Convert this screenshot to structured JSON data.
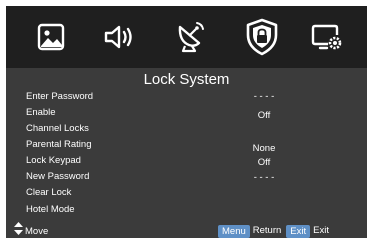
{
  "colors": {
    "top_bar": "#1f1f1f",
    "panel": "#3b3b3b",
    "icon": "#ffffff",
    "key_highlight": "#5f90c6"
  },
  "tabs": [
    {
      "icon": "picture-icon",
      "active": false
    },
    {
      "icon": "sound-icon",
      "active": false
    },
    {
      "icon": "channel-satellite-icon",
      "active": false
    },
    {
      "icon": "lock-shield-icon",
      "active": true
    },
    {
      "icon": "settings-monitor-icon",
      "active": false
    }
  ],
  "menu": {
    "title": "Lock System",
    "items": [
      {
        "label": "Enter Password",
        "value": "- - - -"
      },
      {
        "label": "Enable",
        "value": "Off"
      },
      {
        "label": "Channel Locks",
        "value": ""
      },
      {
        "label": "Parental Rating",
        "value": "None"
      },
      {
        "label": "Lock Keypad",
        "value": "Off"
      },
      {
        "label": "New Password",
        "value": "- - - -"
      },
      {
        "label": "Clear Lock",
        "value": ""
      },
      {
        "label": "Hotel Mode",
        "value": ""
      }
    ]
  },
  "footer": {
    "move_label": "Move",
    "menu_key": "Menu",
    "menu_action": "Return",
    "exit_key": "Exit",
    "exit_action": "Exit"
  }
}
